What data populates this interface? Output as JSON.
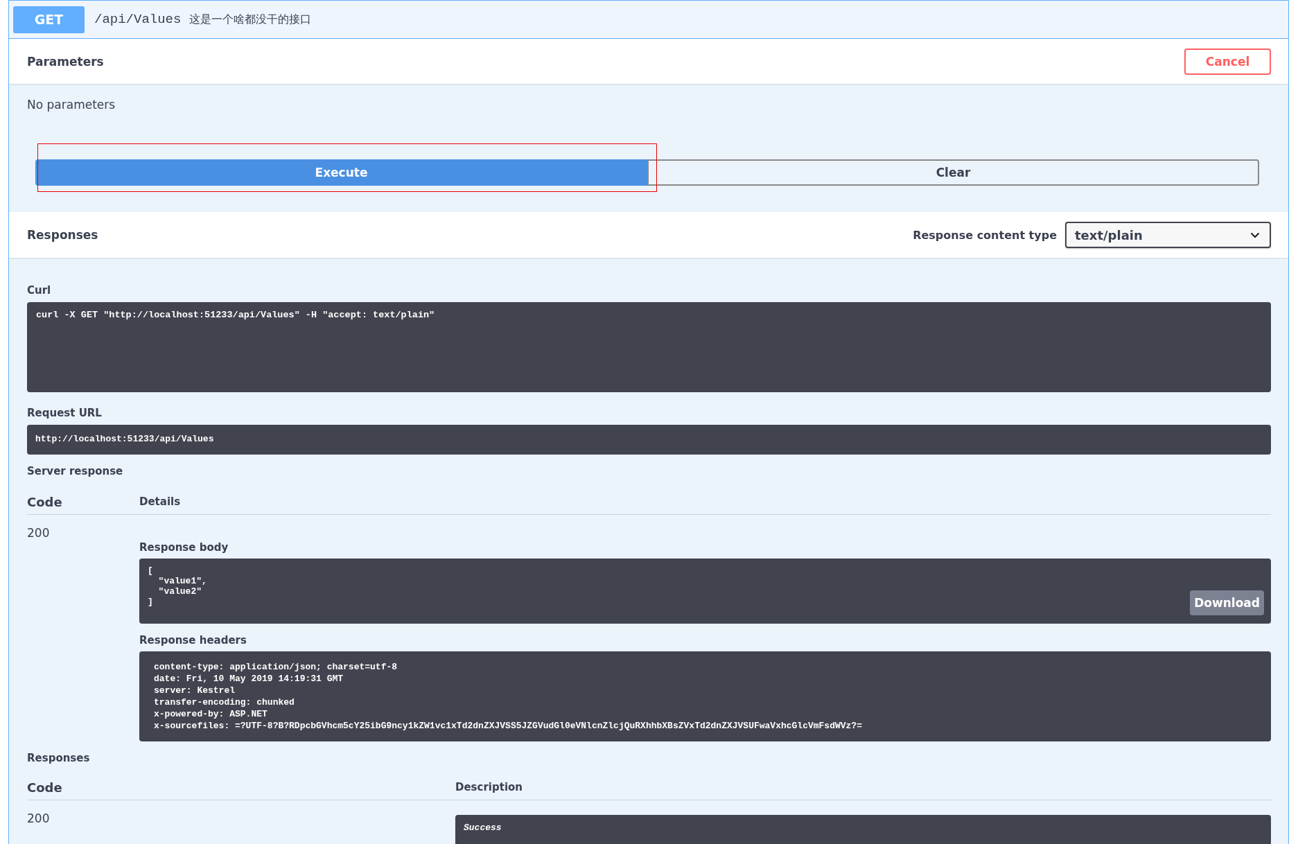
{
  "operation": {
    "method": "GET",
    "path": "/api/Values",
    "summary": "这是一个啥都没干的接口"
  },
  "parameters": {
    "title": "Parameters",
    "cancel_button": "Cancel",
    "message": "No parameters"
  },
  "actions": [
    {
      "label": "Execute",
      "kind": "primary",
      "highlighted": true
    },
    {
      "label": "Clear",
      "kind": "secondary",
      "highlighted": false
    }
  ],
  "responses_header": {
    "title": "Responses",
    "content_type_label": "Response content type",
    "content_type": "text/plain"
  },
  "curl": {
    "label": "Curl",
    "command": "curl -X GET \"http://localhost:51233/api/Values\" -H \"accept: text/plain\""
  },
  "request_url": {
    "label": "Request URL",
    "value": "http://localhost:51233/api/Values"
  },
  "server_response": {
    "label": "Server response",
    "columns": [
      "Code",
      "Details"
    ],
    "code": "200",
    "body_label": "Response body",
    "body": "[\n  \"value1\",\n  \"value2\"\n]",
    "download_button": "Download",
    "headers_label": "Response headers",
    "headers": "content-type: application/json; charset=utf-8\ndate: Fri, 10 May 2019 14:19:31 GMT\nserver: Kestrel\ntransfer-encoding: chunked\nx-powered-by: ASP.NET\nx-sourcefiles: =?UTF-8?B?RDpcbGVhcm5cY25ibG9ncy1kZW1vc1xTd2dnZXJVSS5JZGVudGl0eVNlcnZlcjQuRXhhbXBsZVxTd2dnZXJVSUFwaVxhcGlcVmFsdWVz?="
  },
  "responses": {
    "label": "Responses",
    "columns": [
      "Code",
      "Description"
    ],
    "rows": [
      {
        "code": "200",
        "description": "Success"
      }
    ]
  }
}
